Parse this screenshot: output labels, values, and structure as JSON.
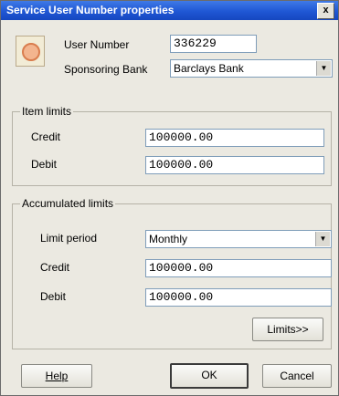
{
  "window": {
    "title": "Service User Number properties",
    "close_glyph": "x"
  },
  "header": {
    "user_number_label": "User Number",
    "user_number_value": "336229",
    "sponsoring_bank_label": "Sponsoring Bank",
    "sponsoring_bank_value": "Barclays Bank"
  },
  "item_limits": {
    "title": "Item limits",
    "credit_label": "Credit",
    "credit_value": "100000.00",
    "debit_label": "Debit",
    "debit_value": "100000.00"
  },
  "accumulated_limits": {
    "title": "Accumulated limits",
    "limit_period_label": "Limit period",
    "limit_period_value": "Monthly",
    "credit_label": "Credit",
    "credit_value": "100000.00",
    "debit_label": "Debit",
    "debit_value": "100000.00",
    "limits_button": "Limits>>"
  },
  "footer": {
    "help": "Help",
    "ok": "OK",
    "cancel": "Cancel"
  },
  "icons": {
    "dropdown": "chevron-down-icon",
    "user": "user-icon"
  }
}
